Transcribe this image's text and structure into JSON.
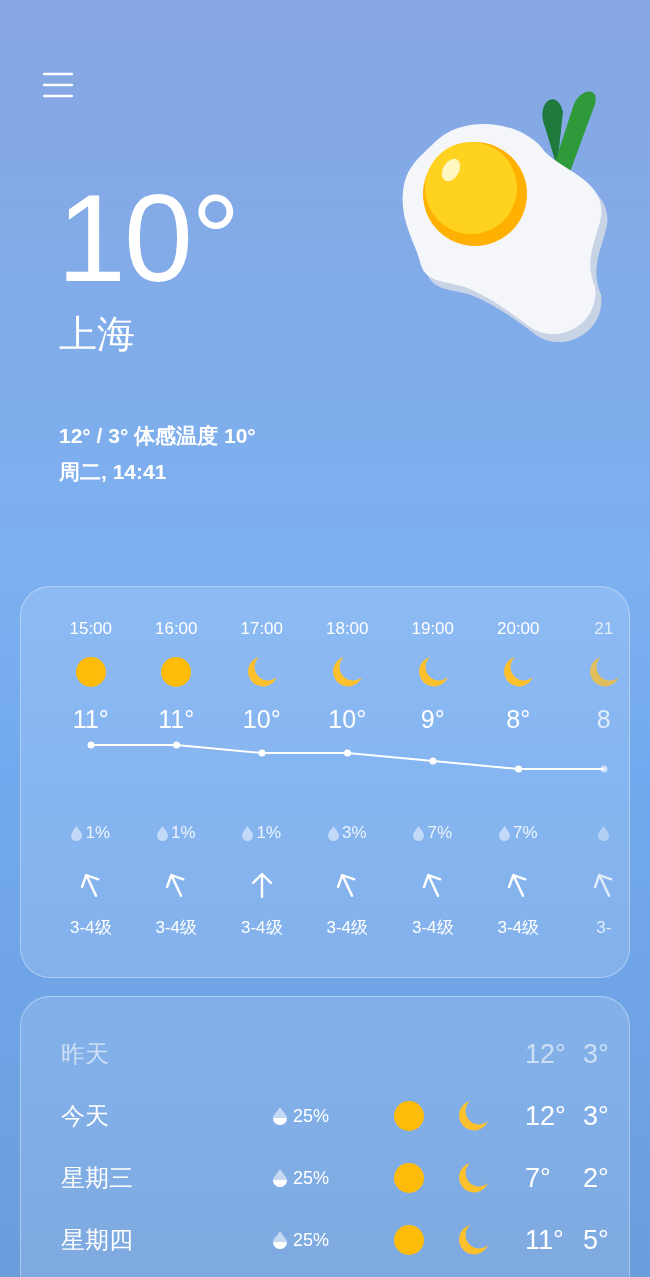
{
  "current": {
    "temperature": "10°",
    "city": "上海",
    "range": "12° / 3° 体感温度 10°",
    "datetime": "周二, 14:41"
  },
  "hourly": [
    {
      "time": "15:00",
      "kind": "sun",
      "temp": "11°",
      "precip": "1%",
      "wind_tilted": true,
      "wind_level": "3-4级",
      "cut": false
    },
    {
      "time": "16:00",
      "kind": "sun",
      "temp": "11°",
      "precip": "1%",
      "wind_tilted": true,
      "wind_level": "3-4级",
      "cut": false
    },
    {
      "time": "17:00",
      "kind": "moon",
      "temp": "10°",
      "precip": "1%",
      "wind_tilted": false,
      "wind_level": "3-4级",
      "cut": false
    },
    {
      "time": "18:00",
      "kind": "moon",
      "temp": "10°",
      "precip": "3%",
      "wind_tilted": true,
      "wind_level": "3-4级",
      "cut": false
    },
    {
      "time": "19:00",
      "kind": "moon",
      "temp": "9°",
      "precip": "7%",
      "wind_tilted": true,
      "wind_level": "3-4级",
      "cut": false
    },
    {
      "time": "20:00",
      "kind": "moon",
      "temp": "8°",
      "precip": "7%",
      "wind_tilted": true,
      "wind_level": "3-4级",
      "cut": false
    },
    {
      "time": "21",
      "kind": "moon",
      "temp": "8",
      "wind_tilted": true,
      "wind_level": "3-",
      "cut": true
    }
  ],
  "daily": [
    {
      "day": "昨天",
      "high": "12°",
      "low": "3°",
      "past": true
    },
    {
      "day": "今天",
      "precip": "25%",
      "high": "12°",
      "low": "3°",
      "past": false
    },
    {
      "day": "星期三",
      "precip": "25%",
      "high": "7°",
      "low": "2°",
      "past": false
    },
    {
      "day": "星期四",
      "precip": "25%",
      "high": "11°",
      "low": "5°",
      "past": false
    }
  ]
}
